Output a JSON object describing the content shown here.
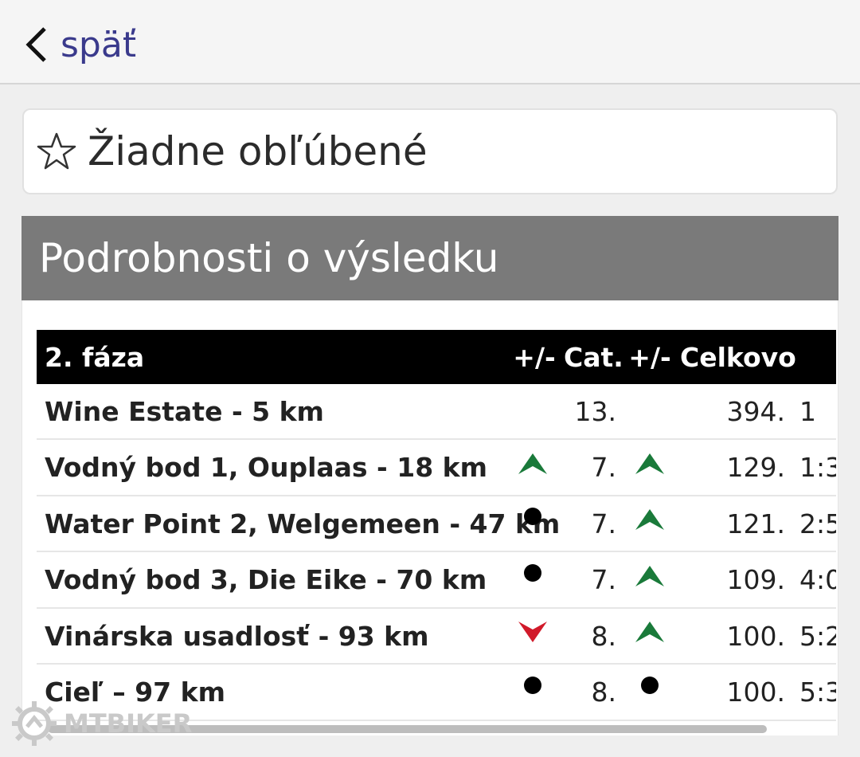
{
  "nav": {
    "back_label": "späť"
  },
  "favorites": {
    "label": "Žiadne obľúbené"
  },
  "section": {
    "title": "Podrobnosti o výsledku"
  },
  "table": {
    "headers": {
      "name": "2. fáza",
      "pm1": "+/-",
      "cat": "Cat.",
      "pm2": "+/-",
      "total": "Celkovo"
    },
    "rows": [
      {
        "name": "Wine Estate - 5 km",
        "trend_cat": "none",
        "cat": "13.",
        "trend_total": "none",
        "total": "394.",
        "time": "1"
      },
      {
        "name": "Vodný bod 1, Ouplaas - 18 km",
        "trend_cat": "up",
        "cat": "7.",
        "trend_total": "up",
        "total": "129.",
        "time": "1:3"
      },
      {
        "name": "Water Point 2, Welgemeen - 47 km",
        "trend_cat": "same",
        "cat": "7.",
        "trend_total": "up",
        "total": "121.",
        "time": "2:5"
      },
      {
        "name": "Vodný bod 3, Die Eike - 70 km",
        "trend_cat": "same",
        "cat": "7.",
        "trend_total": "up",
        "total": "109.",
        "time": "4:0"
      },
      {
        "name": "Vinárska usadlosť - 93 km",
        "trend_cat": "down",
        "cat": "8.",
        "trend_total": "up",
        "total": "100.",
        "time": "5:2"
      },
      {
        "name": "Cieľ – 97 km",
        "trend_cat": "same",
        "cat": "8.",
        "trend_total": "same",
        "total": "100.",
        "time": "5:3"
      }
    ]
  },
  "colors": {
    "up": "#1a7a3a",
    "down": "#d11a2a",
    "same": "#000000",
    "header_bg": "#7a7a7a",
    "link": "#3a3a8c"
  },
  "watermark": {
    "text": "MTBIKER"
  }
}
